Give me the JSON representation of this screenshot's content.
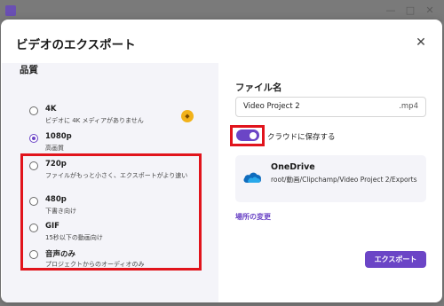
{
  "dialog": {
    "title": "ビデオのエクスポート"
  },
  "quality": {
    "heading": "品質",
    "options": [
      {
        "label": "4K",
        "description": "ビデオに 4K メディアがありません",
        "selected": false,
        "premium": true
      },
      {
        "label": "1080p",
        "description": "高画質",
        "selected": true,
        "premium": false
      },
      {
        "label": "720p",
        "description": "ファイルがもっと小さく、エクスポートがより速い",
        "selected": false,
        "premium": false
      },
      {
        "label": "480p",
        "description": "下書き向け",
        "selected": false,
        "premium": false
      },
      {
        "label": "GIF",
        "description": "15秒以下の動画向け",
        "selected": false,
        "premium": false
      },
      {
        "label": "音声のみ",
        "description": "プロジェクトからのオーディオのみ",
        "selected": false,
        "premium": false
      }
    ]
  },
  "file": {
    "heading": "ファイル名",
    "name_value": "Video Project 2",
    "extension": ".mp4"
  },
  "cloud_save": {
    "label": "クラウドに保存する",
    "enabled": true
  },
  "onedrive": {
    "name": "OneDrive",
    "path": "root/動画/Clipchamp/Video Project 2/Exports"
  },
  "links": {
    "change_location": "場所の変更"
  },
  "actions": {
    "export": "エクスポート"
  },
  "colors": {
    "accent": "#6b45c6",
    "highlight": "#e1141c",
    "premium": "#f2b21a"
  }
}
